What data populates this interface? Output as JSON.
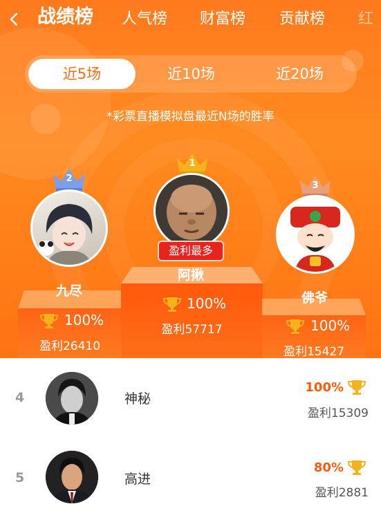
{
  "nav": {
    "tabs": [
      "战绩榜",
      "人气榜",
      "财富榜",
      "贡献榜",
      "红"
    ]
  },
  "filter": {
    "options": [
      "近5场",
      "近10场",
      "近20场"
    ],
    "selected": "近5场"
  },
  "note": "*彩票直播模拟盘最近N场的胜率",
  "podium": {
    "first": {
      "rank": "1",
      "name": "阿揪",
      "badge": "盈利最多",
      "win_rate": "100%",
      "profit": "盈利57717",
      "avatar_icon": "bald-boy-avatar"
    },
    "second": {
      "rank": "2",
      "name": "九尽",
      "win_rate": "100%",
      "profit": "盈利26410",
      "avatar_icon": "anime-boy-avatar"
    },
    "third": {
      "rank": "3",
      "name": "佛爷",
      "win_rate": "100%",
      "profit": "盈利15427",
      "avatar_icon": "god-of-wealth-avatar"
    }
  },
  "list": [
    {
      "rank": "4",
      "name": "神秘",
      "win_rate": "100%",
      "profit": "盈利15309",
      "avatar_icon": "man-photo-avatar"
    },
    {
      "rank": "5",
      "name": "高进",
      "win_rate": "80%",
      "profit": "盈利2881",
      "avatar_icon": "suit-man-avatar"
    }
  ],
  "colors": {
    "accent": "#ff6a10",
    "badge_red": "#e8231e",
    "gold": "#f6b21b",
    "silver_blue": "#7b9fe8",
    "bronze": "#e8a07a"
  }
}
